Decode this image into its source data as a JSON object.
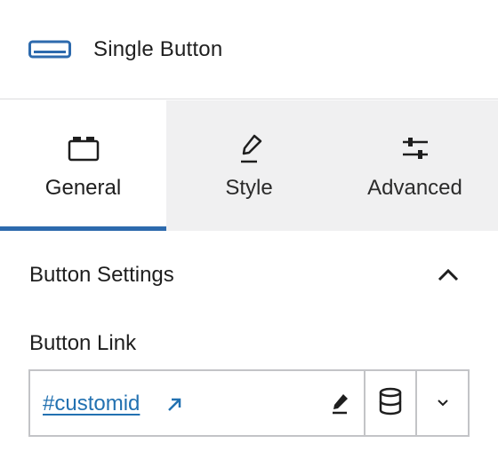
{
  "header": {
    "title": "Single Button",
    "icon": "button-block-icon",
    "accent": "#2d6aad"
  },
  "tabs": [
    {
      "label": "General",
      "icon": "general-tab-icon",
      "active": true
    },
    {
      "label": "Style",
      "icon": "paintbrush-icon",
      "active": false
    },
    {
      "label": "Advanced",
      "icon": "sliders-icon",
      "active": false
    }
  ],
  "panel": {
    "section_title": "Button Settings",
    "collapse_icon": "chevron-up-icon",
    "field_label": "Button Link",
    "link_value": "#customid",
    "link_color": "#2271b1",
    "icons": {
      "external": "external-link-icon",
      "edit": "pencil-icon",
      "dynamic": "database-icon",
      "dropdown": "chevron-down-icon"
    }
  }
}
